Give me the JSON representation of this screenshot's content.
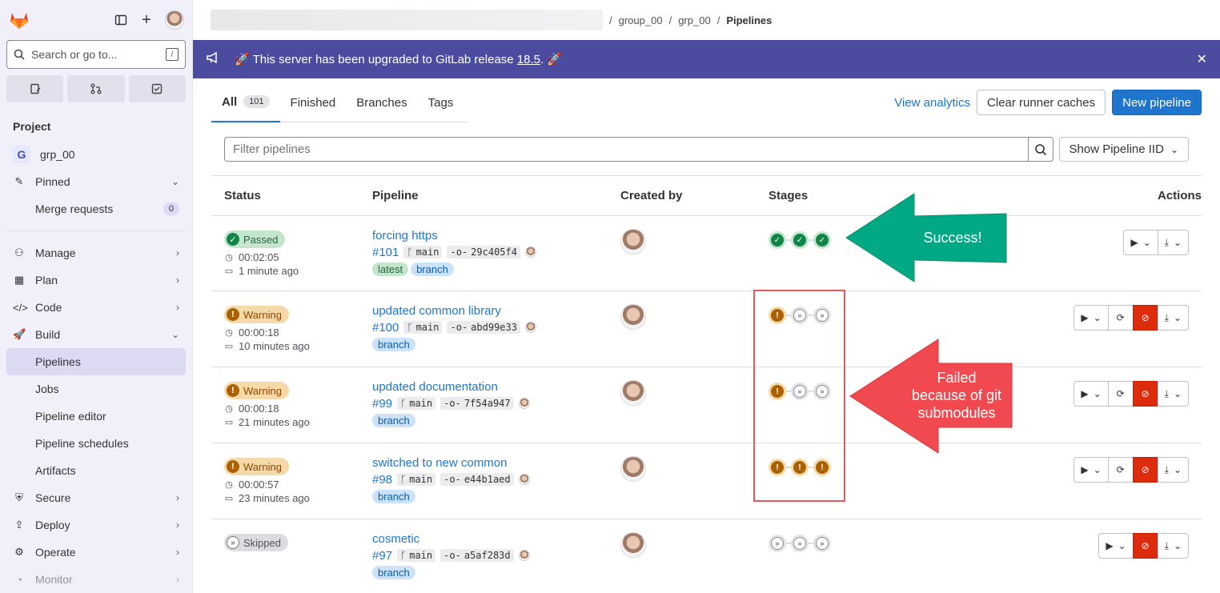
{
  "sidebar": {
    "search_placeholder": "Search or go to...",
    "search_shortcut": "/",
    "project_section": "Project",
    "project_letter": "G",
    "project_name": "grp_00",
    "pinned": "Pinned",
    "merge_requests": "Merge requests",
    "merge_requests_count": "0",
    "items": [
      {
        "label": "Manage",
        "icon": "users-icon"
      },
      {
        "label": "Plan",
        "icon": "calendar-icon"
      },
      {
        "label": "Code",
        "icon": "code-icon"
      },
      {
        "label": "Build",
        "icon": "rocket-icon"
      }
    ],
    "build_sub": [
      "Pipelines",
      "Jobs",
      "Pipeline editor",
      "Pipeline schedules",
      "Artifacts"
    ],
    "items_after": [
      {
        "label": "Secure",
        "icon": "shield-icon"
      },
      {
        "label": "Deploy",
        "icon": "deploy-icon"
      },
      {
        "label": "Operate",
        "icon": "operate-icon"
      },
      {
        "label": "Monitor",
        "icon": "monitor-icon"
      }
    ]
  },
  "breadcrumb": {
    "group": "group_00",
    "project": "grp_00",
    "current": "Pipelines"
  },
  "banner": {
    "text_before": "This server has been upgraded to GitLab release ",
    "version": "18.5",
    "text_after": "."
  },
  "tabs": [
    {
      "label": "All",
      "count": "101"
    },
    {
      "label": "Finished"
    },
    {
      "label": "Branches"
    },
    {
      "label": "Tags"
    }
  ],
  "top_actions": {
    "analytics": "View analytics",
    "clear": "Clear runner caches",
    "new": "New pipeline"
  },
  "filter": {
    "placeholder": "Filter pipelines",
    "iid": "Show Pipeline IID"
  },
  "columns": {
    "status": "Status",
    "pipeline": "Pipeline",
    "created_by": "Created by",
    "stages": "Stages",
    "actions": "Actions"
  },
  "rows": [
    {
      "status": "Passed",
      "duration": "00:02:05",
      "when": "1 minute ago",
      "title": "forcing https",
      "id": "#101",
      "branch": "main",
      "sha": "29c405f4",
      "tags": [
        "latest",
        "branch"
      ]
    },
    {
      "status": "Warning",
      "duration": "00:00:18",
      "when": "10 minutes ago",
      "title": "updated common library",
      "id": "#100",
      "branch": "main",
      "sha": "abd99e33",
      "tags": [
        "branch"
      ]
    },
    {
      "status": "Warning",
      "duration": "00:00:18",
      "when": "21 minutes ago",
      "title": "updated documentation",
      "id": "#99",
      "branch": "main",
      "sha": "7f54a947",
      "tags": [
        "branch"
      ]
    },
    {
      "status": "Warning",
      "duration": "00:00:57",
      "when": "23 minutes ago",
      "title": "switched to new common",
      "id": "#98",
      "branch": "main",
      "sha": "e44b1aed",
      "tags": [
        "branch"
      ]
    },
    {
      "status": "Skipped",
      "duration": "",
      "when": "",
      "title": "cosmetic",
      "id": "#97",
      "branch": "main",
      "sha": "a5af283d",
      "tags": [
        "branch"
      ]
    }
  ],
  "annotations": {
    "success": "Success!",
    "failed_1": "Failed",
    "failed_2": "because of git",
    "failed_3": "submodules"
  },
  "colors": {
    "accent": "#1f75cb",
    "banner": "#4b4ba0",
    "success_arrow": "#00a884",
    "failed_arrow": "#f04a50",
    "cancel": "#dd2b0e"
  }
}
